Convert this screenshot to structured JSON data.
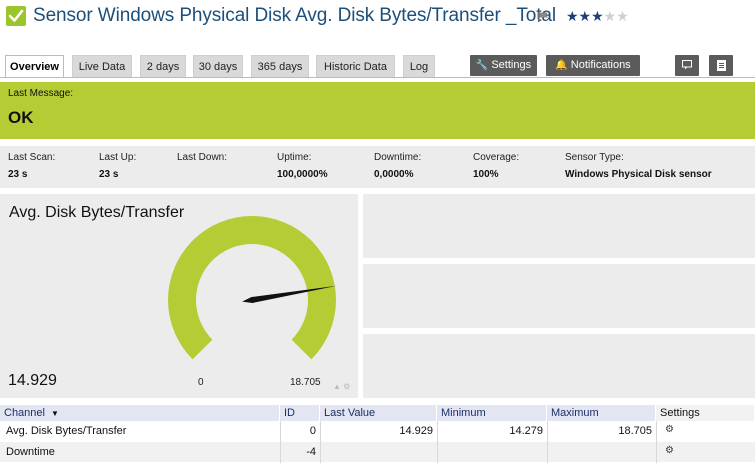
{
  "header": {
    "title": "Sensor Windows Physical Disk Avg. Disk Bytes/Transfer _Total",
    "status_icon": "check-icon",
    "flag_icon": "flag-icon",
    "rating": 3,
    "rating_max": 5,
    "stars_on": "★★★",
    "stars_off": "★★",
    "colors": {
      "title": "#1c4f7a",
      "status": "#9bc42d",
      "star": "#1c3f7a"
    }
  },
  "tabs": {
    "items": [
      {
        "label": "Overview",
        "active": true
      },
      {
        "label": "Live Data",
        "active": false
      },
      {
        "label": "2 days",
        "active": false
      },
      {
        "label": "30 days",
        "active": false
      },
      {
        "label": "365 days",
        "active": false
      },
      {
        "label": "Historic Data",
        "active": false
      },
      {
        "label": "Log",
        "active": false
      }
    ],
    "settings_label": "Settings",
    "notifications_label": "Notifications",
    "comment_icon": "comment-icon",
    "doc_icon": "document-icon"
  },
  "message": {
    "label": "Last Message:",
    "value": "OK",
    "color": "#b6cc35"
  },
  "stats": [
    {
      "label": "Last Scan:",
      "value": "23 s"
    },
    {
      "label": "Last Up:",
      "value": "23 s"
    },
    {
      "label": "Last Down:",
      "value": ""
    },
    {
      "label": "Uptime:",
      "value": "100,0000%"
    },
    {
      "label": "Downtime:",
      "value": "0,0000%"
    },
    {
      "label": "Coverage:",
      "value": "100%"
    },
    {
      "label": "Sensor Type:",
      "value": "Windows Physical Disk sensor"
    }
  ],
  "gauge": {
    "title": "Avg. Disk Bytes/Transfer",
    "current": "14.929",
    "min_label": "0",
    "max_label": "18.705",
    "value": 14.929,
    "min": 0,
    "max": 18.705,
    "color": "#b6cc35"
  },
  "table": {
    "headers": {
      "channel": "Channel",
      "id": "ID",
      "last_value": "Last Value",
      "minimum": "Minimum",
      "maximum": "Maximum",
      "settings": "Settings"
    },
    "rows": [
      {
        "channel": "Avg. Disk Bytes/Transfer",
        "id": "0",
        "last_value": "14.929",
        "minimum": "14.279",
        "maximum": "18.705"
      },
      {
        "channel": "Downtime",
        "id": "-4",
        "last_value": "",
        "minimum": "",
        "maximum": ""
      }
    ]
  }
}
